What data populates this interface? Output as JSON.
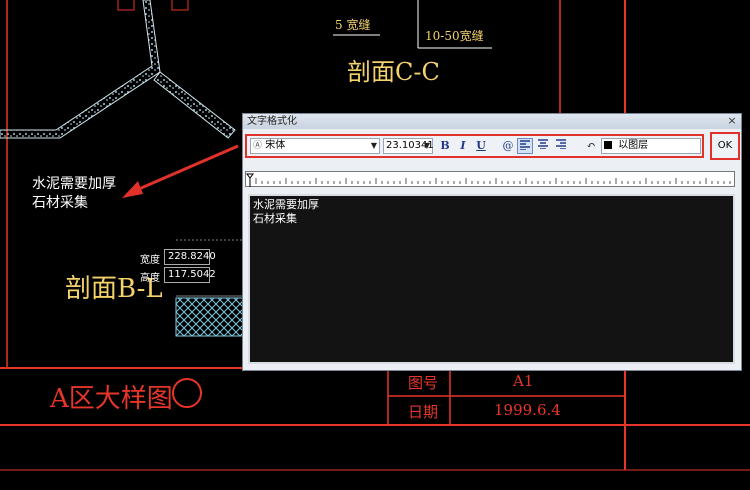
{
  "drawing": {
    "annotation_crack": "5 宽缝",
    "annotation_crack_range": "10-50宽缝",
    "section_cc": "剖面C-C",
    "section_bb": "剖面B-L",
    "note_line1": "水泥需要加厚",
    "note_line2": "石材采集",
    "width_label": "宽度",
    "width_value": "228.8240",
    "height_label": "高度",
    "height_value": "117.5042",
    "sheet_title": "A区大样图",
    "sheet_number_circle": "①",
    "table_drawing_no_label": "图号",
    "table_drawing_no_value": "A1",
    "table_date_label": "日期",
    "table_date_value": "1999.6.4",
    "colors": {
      "annotation": "#f5d36b",
      "frame": "#e8352a",
      "hatch": "#7ec8e0"
    }
  },
  "dialog": {
    "title": "文字格式化",
    "close_icon": "close-icon",
    "font_value": "宋体",
    "font_size_value": "23.10341",
    "bold_label": "B",
    "italic_label": "I",
    "underline_label": "U",
    "layer_label": "以图层",
    "ok_label": "OK",
    "editor_line1": "水泥需要加厚",
    "editor_line2": "石材采集"
  }
}
